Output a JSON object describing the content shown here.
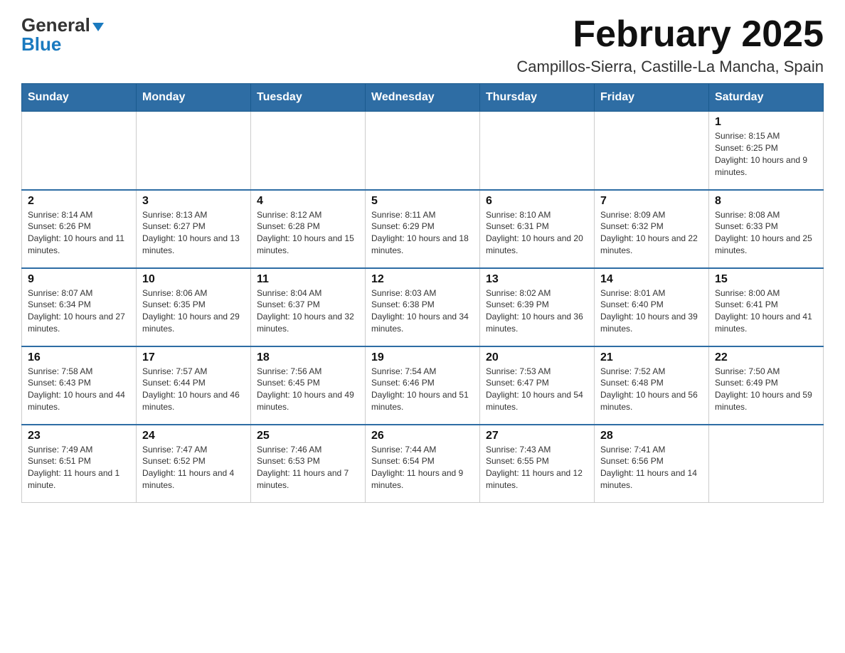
{
  "header": {
    "logo_line1": "General",
    "logo_line2": "Blue",
    "title": "February 2025",
    "subtitle": "Campillos-Sierra, Castille-La Mancha, Spain"
  },
  "calendar": {
    "days_of_week": [
      "Sunday",
      "Monday",
      "Tuesday",
      "Wednesday",
      "Thursday",
      "Friday",
      "Saturday"
    ],
    "weeks": [
      [
        {
          "day": "",
          "info": ""
        },
        {
          "day": "",
          "info": ""
        },
        {
          "day": "",
          "info": ""
        },
        {
          "day": "",
          "info": ""
        },
        {
          "day": "",
          "info": ""
        },
        {
          "day": "",
          "info": ""
        },
        {
          "day": "1",
          "info": "Sunrise: 8:15 AM\nSunset: 6:25 PM\nDaylight: 10 hours and 9 minutes."
        }
      ],
      [
        {
          "day": "2",
          "info": "Sunrise: 8:14 AM\nSunset: 6:26 PM\nDaylight: 10 hours and 11 minutes."
        },
        {
          "day": "3",
          "info": "Sunrise: 8:13 AM\nSunset: 6:27 PM\nDaylight: 10 hours and 13 minutes."
        },
        {
          "day": "4",
          "info": "Sunrise: 8:12 AM\nSunset: 6:28 PM\nDaylight: 10 hours and 15 minutes."
        },
        {
          "day": "5",
          "info": "Sunrise: 8:11 AM\nSunset: 6:29 PM\nDaylight: 10 hours and 18 minutes."
        },
        {
          "day": "6",
          "info": "Sunrise: 8:10 AM\nSunset: 6:31 PM\nDaylight: 10 hours and 20 minutes."
        },
        {
          "day": "7",
          "info": "Sunrise: 8:09 AM\nSunset: 6:32 PM\nDaylight: 10 hours and 22 minutes."
        },
        {
          "day": "8",
          "info": "Sunrise: 8:08 AM\nSunset: 6:33 PM\nDaylight: 10 hours and 25 minutes."
        }
      ],
      [
        {
          "day": "9",
          "info": "Sunrise: 8:07 AM\nSunset: 6:34 PM\nDaylight: 10 hours and 27 minutes."
        },
        {
          "day": "10",
          "info": "Sunrise: 8:06 AM\nSunset: 6:35 PM\nDaylight: 10 hours and 29 minutes."
        },
        {
          "day": "11",
          "info": "Sunrise: 8:04 AM\nSunset: 6:37 PM\nDaylight: 10 hours and 32 minutes."
        },
        {
          "day": "12",
          "info": "Sunrise: 8:03 AM\nSunset: 6:38 PM\nDaylight: 10 hours and 34 minutes."
        },
        {
          "day": "13",
          "info": "Sunrise: 8:02 AM\nSunset: 6:39 PM\nDaylight: 10 hours and 36 minutes."
        },
        {
          "day": "14",
          "info": "Sunrise: 8:01 AM\nSunset: 6:40 PM\nDaylight: 10 hours and 39 minutes."
        },
        {
          "day": "15",
          "info": "Sunrise: 8:00 AM\nSunset: 6:41 PM\nDaylight: 10 hours and 41 minutes."
        }
      ],
      [
        {
          "day": "16",
          "info": "Sunrise: 7:58 AM\nSunset: 6:43 PM\nDaylight: 10 hours and 44 minutes."
        },
        {
          "day": "17",
          "info": "Sunrise: 7:57 AM\nSunset: 6:44 PM\nDaylight: 10 hours and 46 minutes."
        },
        {
          "day": "18",
          "info": "Sunrise: 7:56 AM\nSunset: 6:45 PM\nDaylight: 10 hours and 49 minutes."
        },
        {
          "day": "19",
          "info": "Sunrise: 7:54 AM\nSunset: 6:46 PM\nDaylight: 10 hours and 51 minutes."
        },
        {
          "day": "20",
          "info": "Sunrise: 7:53 AM\nSunset: 6:47 PM\nDaylight: 10 hours and 54 minutes."
        },
        {
          "day": "21",
          "info": "Sunrise: 7:52 AM\nSunset: 6:48 PM\nDaylight: 10 hours and 56 minutes."
        },
        {
          "day": "22",
          "info": "Sunrise: 7:50 AM\nSunset: 6:49 PM\nDaylight: 10 hours and 59 minutes."
        }
      ],
      [
        {
          "day": "23",
          "info": "Sunrise: 7:49 AM\nSunset: 6:51 PM\nDaylight: 11 hours and 1 minute."
        },
        {
          "day": "24",
          "info": "Sunrise: 7:47 AM\nSunset: 6:52 PM\nDaylight: 11 hours and 4 minutes."
        },
        {
          "day": "25",
          "info": "Sunrise: 7:46 AM\nSunset: 6:53 PM\nDaylight: 11 hours and 7 minutes."
        },
        {
          "day": "26",
          "info": "Sunrise: 7:44 AM\nSunset: 6:54 PM\nDaylight: 11 hours and 9 minutes."
        },
        {
          "day": "27",
          "info": "Sunrise: 7:43 AM\nSunset: 6:55 PM\nDaylight: 11 hours and 12 minutes."
        },
        {
          "day": "28",
          "info": "Sunrise: 7:41 AM\nSunset: 6:56 PM\nDaylight: 11 hours and 14 minutes."
        },
        {
          "day": "",
          "info": ""
        }
      ]
    ]
  }
}
